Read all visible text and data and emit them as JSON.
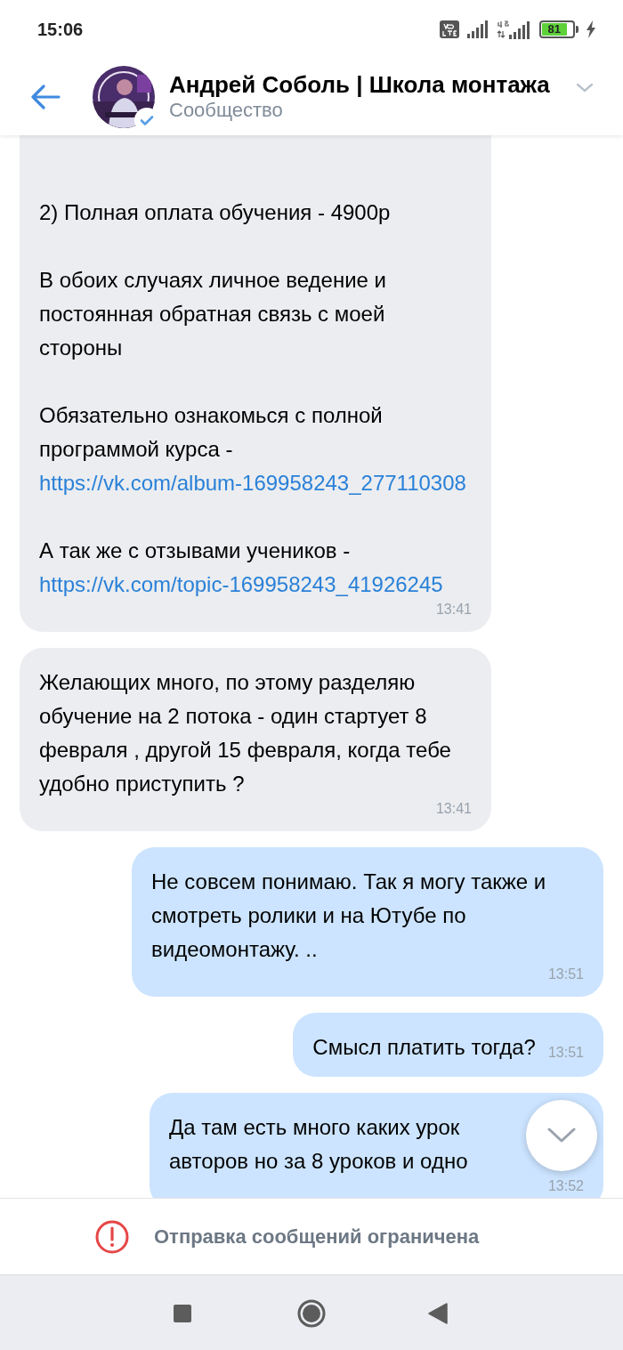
{
  "status_bar": {
    "time": "15:06",
    "battery": "81",
    "charging": true
  },
  "header": {
    "title": "Андрей Соболь | Школа монтажа",
    "subtitle": "Сообщество",
    "verified": true
  },
  "messages": [
    {
      "kind": "incoming",
      "cut_top": true,
      "paragraphs": [
        {
          "text": "2) Полная оплата обучения - 4900р"
        },
        {
          "text": "В обоих случаях личное ведение и постоянная обратная связь с моей стороны"
        },
        {
          "text": "Обязательно ознакомься с полной программой курса -",
          "link": "https://vk.com/album-169958243_277110308"
        },
        {
          "text": "А так же с отзывами учеников -",
          "link": "https://vk.com/topic-169958243_41926245"
        }
      ],
      "time": "13:41"
    },
    {
      "kind": "incoming",
      "paragraphs": [
        {
          "text": "Желающих много, по этому разделяю обучение на 2 потока - один стартует 8 февраля , другой 15 февраля, когда тебе удобно приступить ?"
        }
      ],
      "time": "13:41"
    },
    {
      "kind": "outgoing",
      "paragraphs": [
        {
          "text": "Не совсем понимаю. Так я могу также и смотреть ролики и на Ютубе по видеомонтажу. .."
        }
      ],
      "time": "13:51"
    },
    {
      "kind": "outgoing",
      "paragraphs": [
        {
          "text": "Смысл платить тогда?"
        }
      ],
      "time": "13:51"
    },
    {
      "kind": "outgoing",
      "lines": [
        "Да там есть много каких урок",
        "авторов но за 8 уроков и одно"
      ],
      "time": "13:52"
    }
  ],
  "footer": {
    "notice": "Отправка сообщений ограничена"
  }
}
